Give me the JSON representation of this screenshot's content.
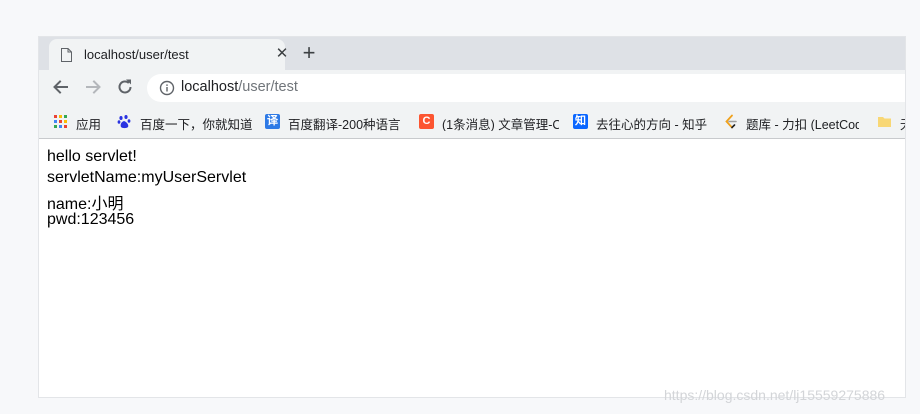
{
  "tab": {
    "title": "localhost/user/test",
    "close": "✕",
    "new_tab": "+"
  },
  "address_bar": {
    "host": "localhost",
    "path": "/user/test"
  },
  "icons": {
    "tab_favicon": "page-icon",
    "back": "arrow-left-icon",
    "forward": "arrow-right-icon",
    "reload": "reload-icon",
    "site_info": "info-icon"
  },
  "bookmarks": [
    {
      "label": "应用",
      "icon": "apps-grid-icon",
      "icon_text": ""
    },
    {
      "label": "百度一下，你就知道",
      "icon": "baidu-icon",
      "icon_text": "",
      "color": "#2932e1"
    },
    {
      "label": "百度翻译-200种语言",
      "icon": "baidu-translate-icon",
      "icon_text": "译",
      "color": "#2e7ae6"
    },
    {
      "label": "(1条消息) 文章管理-C",
      "icon": "csdn-icon",
      "icon_text": "C",
      "color": "#fc5531"
    },
    {
      "label": "去往心的方向 - 知乎",
      "icon": "zhihu-icon",
      "icon_text": "知",
      "color": "#0a66ff"
    },
    {
      "label": "题库 - 力扣 (LeetCod",
      "icon": "leetcode-icon",
      "icon_text": "",
      "color": "#f0a11c"
    },
    {
      "label": "无",
      "icon": "folder-icon",
      "icon_text": "",
      "color": "#f8d775"
    }
  ],
  "page": {
    "lines": [
      "hello servlet!",
      "servletName:myUserServlet",
      "name:小明",
      "pwd:123456"
    ]
  },
  "watermark": "https://blog.csdn.net/lj15559275886"
}
